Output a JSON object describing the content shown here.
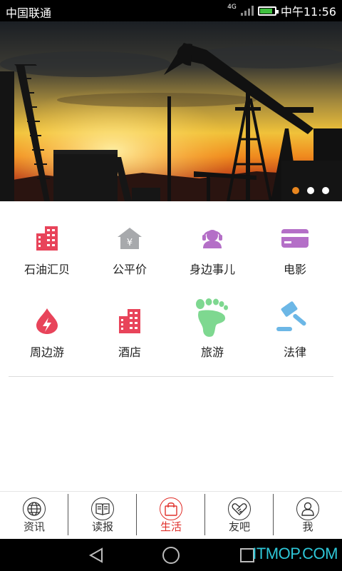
{
  "status_bar": {
    "carrier": "中国联通",
    "network": "4G",
    "time": "中午11:56",
    "battery_level": 0.85
  },
  "banner": {
    "pages": 3,
    "active_page": 1,
    "dot_active_color": "#e8861f"
  },
  "services": [
    {
      "label": "石油汇贝",
      "icon": "building-icon",
      "color": "#e8445a"
    },
    {
      "label": "公平价",
      "icon": "yuan-house-icon",
      "color": "#a7a9ac"
    },
    {
      "label": "身边事儿",
      "icon": "headset-person-icon",
      "color": "#b46fc7"
    },
    {
      "label": "电影",
      "icon": "ticket-card-icon",
      "color": "#b46fc7"
    },
    {
      "label": "周边游",
      "icon": "flash-drop-icon",
      "color": "#e8445a"
    },
    {
      "label": "酒店",
      "icon": "hotel-building-icon",
      "color": "#e8445a"
    },
    {
      "label": "旅游",
      "icon": "footprint-icon",
      "color": "#7ed890"
    },
    {
      "label": "法律",
      "icon": "gavel-icon",
      "color": "#6cb7e6"
    }
  ],
  "tabs": [
    {
      "label": "资讯",
      "icon": "globe-icon"
    },
    {
      "label": "读报",
      "icon": "book-icon"
    },
    {
      "label": "生活",
      "icon": "shopping-bag-icon",
      "active": true
    },
    {
      "label": "友吧",
      "icon": "handshake-icon"
    },
    {
      "label": "我",
      "icon": "person-icon"
    }
  ],
  "colors": {
    "accent": "#e0302b"
  },
  "watermark": "ITMOP.COM"
}
